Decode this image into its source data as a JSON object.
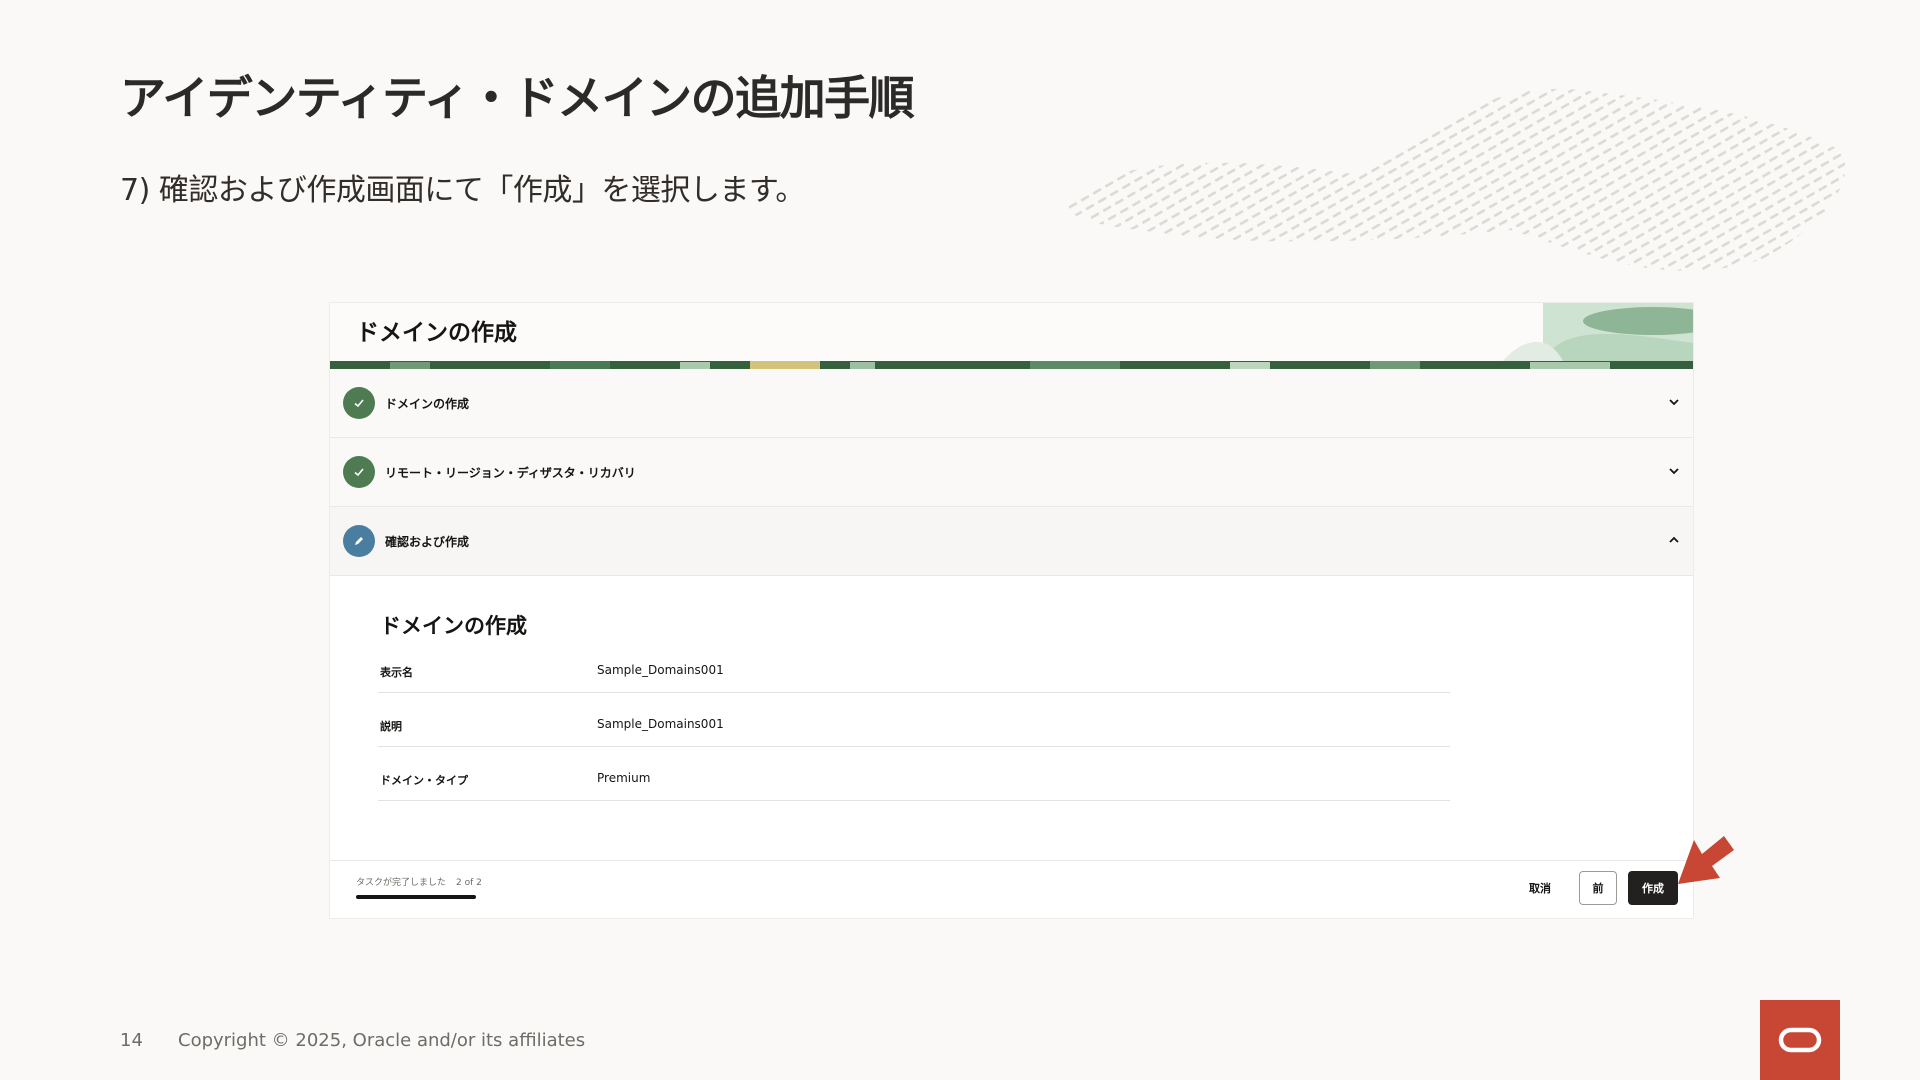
{
  "slide": {
    "title": "アイデンティティ・ドメインの追加手順",
    "subtitle": "7) 確認および作成画面にて「作成」を選択します。",
    "page_number": "14",
    "copyright": "Copyright © 2025, Oracle and/or its affiliates"
  },
  "wizard": {
    "title": "ドメインの作成",
    "steps": [
      {
        "label": "ドメインの作成",
        "state": "complete"
      },
      {
        "label": "リモート・リージョン・ディザスタ・リカバリ",
        "state": "complete"
      },
      {
        "label": "確認および作成",
        "state": "current"
      }
    ],
    "review": {
      "section_title": "ドメインの作成",
      "rows": [
        {
          "key": "表示名",
          "value": "Sample_Domains001"
        },
        {
          "key": "説明",
          "value": "Sample_Domains001"
        },
        {
          "key": "ドメイン・タイプ",
          "value": "Premium"
        }
      ]
    },
    "footer": {
      "progress_label": "タスクが完了しました",
      "progress_count": "2 of 2",
      "progress_fraction": 1.0,
      "cancel_label": "取消",
      "prev_label": "前",
      "create_label": "作成"
    }
  },
  "colors": {
    "step_complete": "#4e7b51",
    "step_current": "#4a7ea0",
    "primary_button": "#232120",
    "callout_arrow": "#c74634",
    "oracle_red": "#c74634"
  },
  "icons": {
    "step_complete": "check-icon",
    "step_current": "pencil-icon",
    "collapsed": "chevron-down-icon",
    "expanded": "chevron-up-icon",
    "brand": "oracle-logo-icon"
  }
}
